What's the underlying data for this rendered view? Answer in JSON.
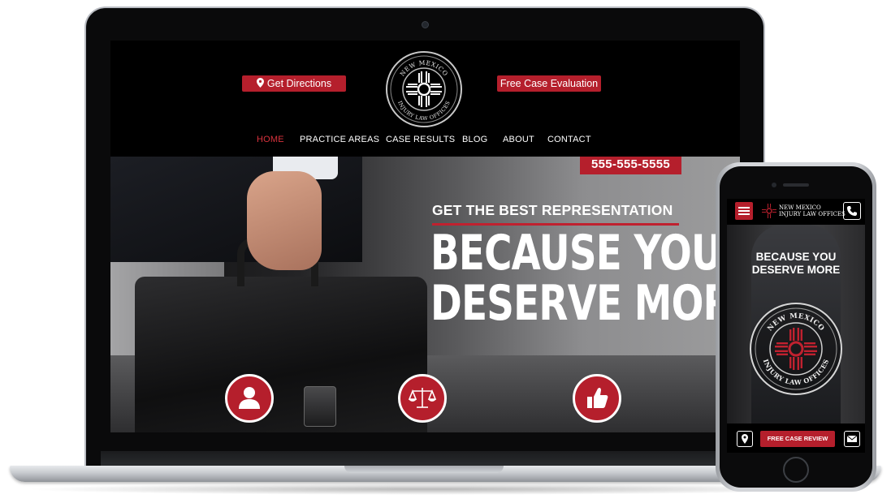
{
  "desktop_site": {
    "header": {
      "directions_button": "Get Directions",
      "evaluation_button": "Free Case Evaluation",
      "logo_text_top": "NEW MEXICO",
      "logo_text_bottom": "INJURY LAW OFFICES"
    },
    "nav": {
      "items": [
        "HOME",
        "PRACTICE AREAS",
        "CASE RESULTS",
        "BLOG",
        "ABOUT",
        "CONTACT"
      ],
      "active": "HOME"
    },
    "hero": {
      "phone": "555-555-5555",
      "tagline": "GET THE BEST REPRESENTATION",
      "headline_line1": "BECAUSE YOU",
      "headline_line2": "DESERVE MORE"
    },
    "feature_icons": [
      "person-icon",
      "scales-icon",
      "thumbs-up-icon"
    ]
  },
  "mobile_site": {
    "logo_line1": "NEW MEXICO",
    "logo_line2": "INJURY LAW OFFICES",
    "headline_line1": "BECAUSE YOU",
    "headline_line2": "DESERVE MORE",
    "seal_text_top": "NEW MEXICO",
    "seal_text_bottom": "INJURY LAW OFFICES",
    "review_button": "FREE CASE REVIEW",
    "icons": [
      "menu-icon",
      "phone-icon",
      "map-pin-icon",
      "mail-icon"
    ]
  },
  "colors": {
    "brand_red": "#b51f2c",
    "active_nav": "#d8323d",
    "background": "#000000"
  }
}
